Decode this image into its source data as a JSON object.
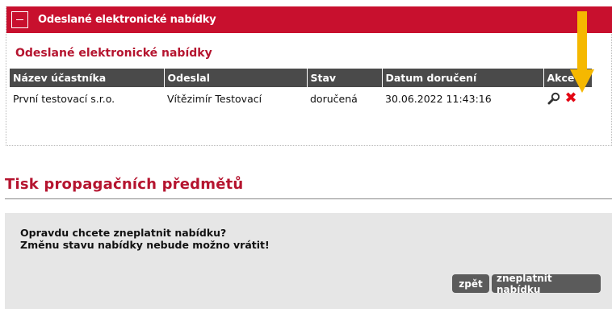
{
  "panel": {
    "header_title": "Odeslané elektronické nabídky",
    "section_title": "Odeslané elektronické nabídky"
  },
  "table": {
    "headers": [
      "Název účastníka",
      "Odeslal",
      "Stav",
      "Datum doručení",
      "Akce"
    ],
    "rows": [
      [
        "První testovací s.r.o.",
        "Vítězimír Testovací",
        "doručená",
        "30.06.2022 11:43:16"
      ]
    ],
    "action_icons": [
      "magnifier-icon",
      "delete-x-icon"
    ]
  },
  "page_heading": "Tisk propagačních předmětů",
  "confirm": {
    "line1": "Opravdu chcete zneplatnit nabídku?",
    "line2": "Změnu stavu nabídky nebude možno vrátit!",
    "back_label": "zpět",
    "invalidate_label": "zneplatnit nabídku"
  },
  "colors": {
    "brand_red": "#c8102e",
    "header_gray": "#4a4a4a",
    "arrow_yellow": "#f5b800",
    "delete_red": "#e30613"
  }
}
